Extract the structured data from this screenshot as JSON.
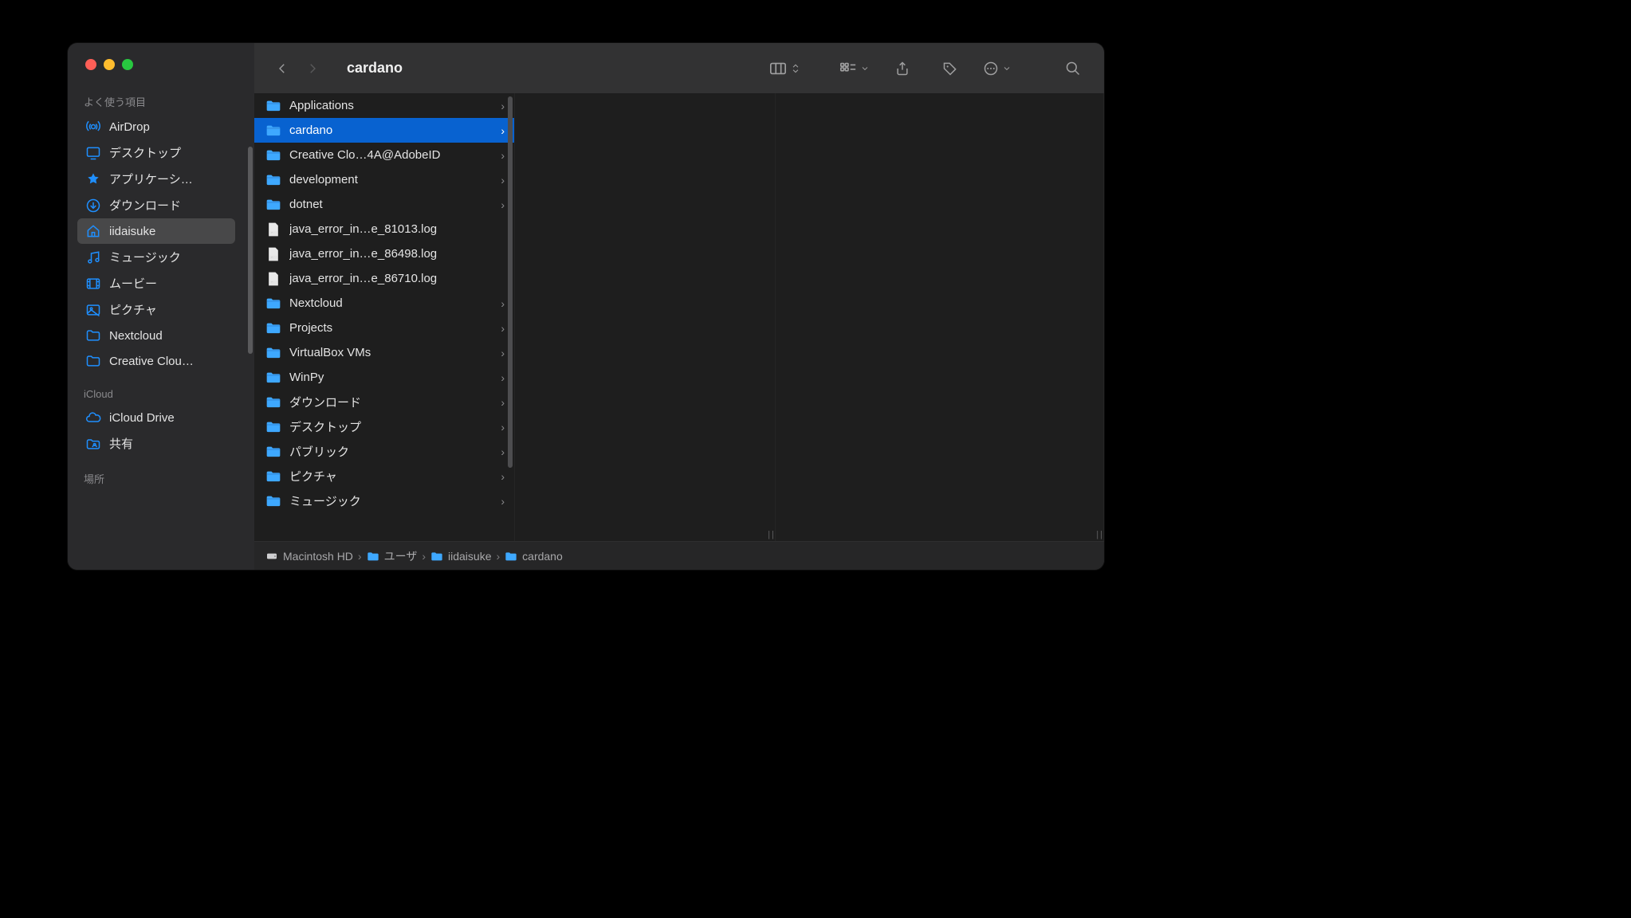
{
  "window": {
    "title": "cardano"
  },
  "sidebar": {
    "sections": [
      {
        "label": "よく使う項目",
        "items": [
          {
            "icon": "airdrop-icon",
            "label": "AirDrop",
            "active": false
          },
          {
            "icon": "desktop-icon",
            "label": "デスクトップ",
            "active": false
          },
          {
            "icon": "applications-icon",
            "label": "アプリケーシ…",
            "active": false
          },
          {
            "icon": "downloads-icon",
            "label": "ダウンロード",
            "active": false
          },
          {
            "icon": "home-icon",
            "label": "iidaisuke",
            "active": true
          },
          {
            "icon": "music-icon",
            "label": "ミュージック",
            "active": false
          },
          {
            "icon": "movies-icon",
            "label": "ムービー",
            "active": false
          },
          {
            "icon": "pictures-icon",
            "label": "ピクチャ",
            "active": false
          },
          {
            "icon": "folder-icon",
            "label": "Nextcloud",
            "active": false
          },
          {
            "icon": "folder-icon",
            "label": "Creative Clou…",
            "active": false
          }
        ]
      },
      {
        "label": "iCloud",
        "items": [
          {
            "icon": "icloud-icon",
            "label": "iCloud Drive",
            "active": false
          },
          {
            "icon": "shared-icon",
            "label": "共有",
            "active": false
          }
        ]
      },
      {
        "label": "場所",
        "items": []
      }
    ]
  },
  "column": {
    "items": [
      {
        "type": "folder",
        "label": "Applications",
        "selected": false
      },
      {
        "type": "folder",
        "label": "cardano",
        "selected": true
      },
      {
        "type": "folder",
        "label": "Creative Clo…4A@AdobeID",
        "selected": false
      },
      {
        "type": "folder",
        "label": "development",
        "selected": false
      },
      {
        "type": "folder",
        "label": "dotnet",
        "selected": false
      },
      {
        "type": "file",
        "label": "java_error_in…e_81013.log",
        "selected": false
      },
      {
        "type": "file",
        "label": "java_error_in…e_86498.log",
        "selected": false
      },
      {
        "type": "file",
        "label": "java_error_in…e_86710.log",
        "selected": false
      },
      {
        "type": "folder",
        "label": "Nextcloud",
        "selected": false
      },
      {
        "type": "folder",
        "label": "Projects",
        "selected": false
      },
      {
        "type": "folder",
        "label": "VirtualBox VMs",
        "selected": false
      },
      {
        "type": "folder",
        "label": "WinPy",
        "selected": false
      },
      {
        "type": "folder",
        "label": "ダウンロード",
        "selected": false
      },
      {
        "type": "folder",
        "label": "デスクトップ",
        "selected": false
      },
      {
        "type": "folder",
        "label": "パブリック",
        "selected": false
      },
      {
        "type": "folder",
        "label": "ピクチャ",
        "selected": false
      },
      {
        "type": "folder",
        "label": "ミュージック",
        "selected": false
      }
    ]
  },
  "pathbar": [
    {
      "icon": "disk-icon",
      "label": "Macintosh HD"
    },
    {
      "icon": "folder-small-icon",
      "label": "ユーザ"
    },
    {
      "icon": "folder-small-icon",
      "label": "iidaisuke"
    },
    {
      "icon": "folder-small-icon",
      "label": "cardano"
    }
  ],
  "toolbar_labels": {
    "back": "Back",
    "forward": "Forward",
    "view": "Column View",
    "group": "Group",
    "share": "Share",
    "tags": "Tags",
    "actions": "Actions",
    "search": "Search"
  }
}
